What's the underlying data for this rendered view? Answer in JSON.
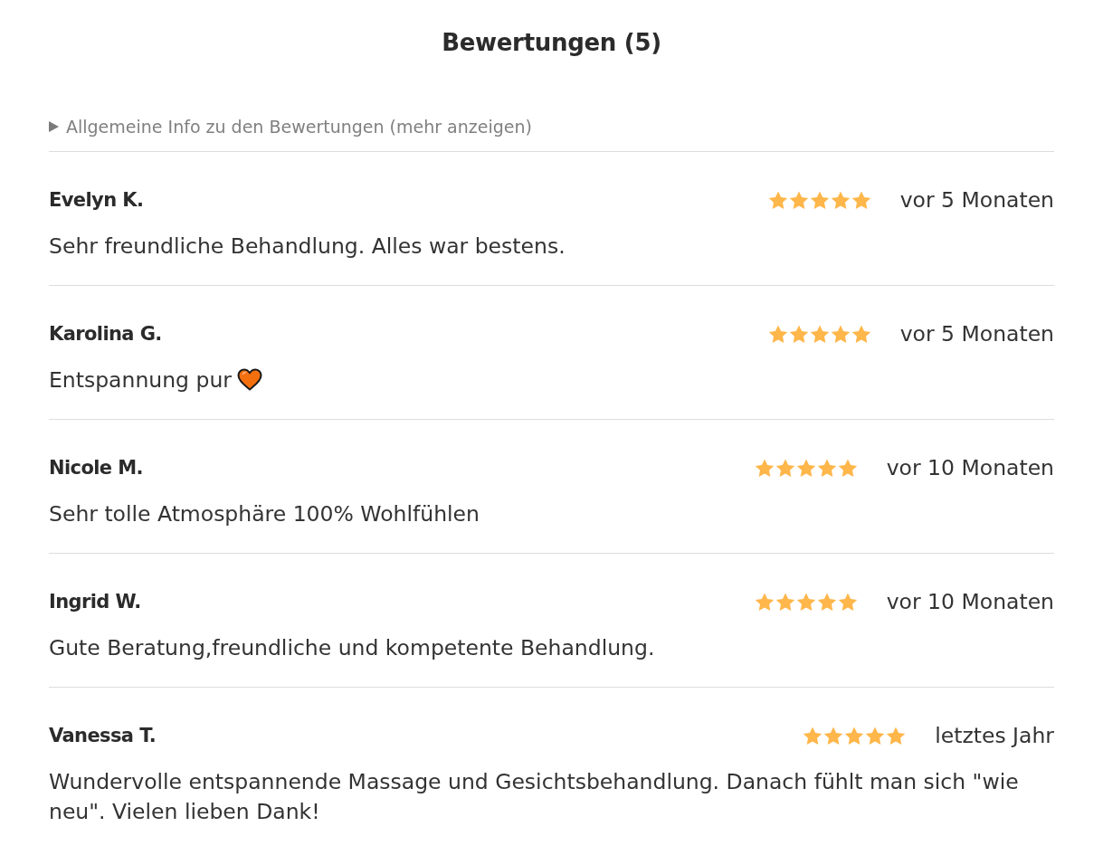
{
  "title": "Bewertungen (5)",
  "info": {
    "label": "Allgemeine Info zu den Bewertungen (mehr anzeigen)",
    "expanded": false
  },
  "reviews": [
    {
      "name": "Evelyn K.",
      "stars": 5,
      "date": "vor 5 Monaten",
      "text": "Sehr freundliche Behandlung. Alles war bestens.",
      "has_emoji": false
    },
    {
      "name": "Karolina G.",
      "stars": 5,
      "date": "vor 5 Monaten",
      "text": "Entspannung pur",
      "has_emoji": true
    },
    {
      "name": "Nicole M.",
      "stars": 5,
      "date": "vor 10 Monaten",
      "text": "Sehr tolle Atmosphäre 100% Wohlfühlen",
      "has_emoji": false
    },
    {
      "name": "Ingrid W.",
      "stars": 5,
      "date": "vor 10 Monaten",
      "text": "Gute Beratung,freundliche und kompetente Behandlung.",
      "has_emoji": false
    },
    {
      "name": "Vanessa T.",
      "stars": 5,
      "date": "letztes Jahr",
      "text": "Wundervolle entspannende Massage und Gesichtsbehandlung. Danach fühlt man sich \"wie neu\". Vielen lieben Dank!",
      "has_emoji": false
    }
  ]
}
